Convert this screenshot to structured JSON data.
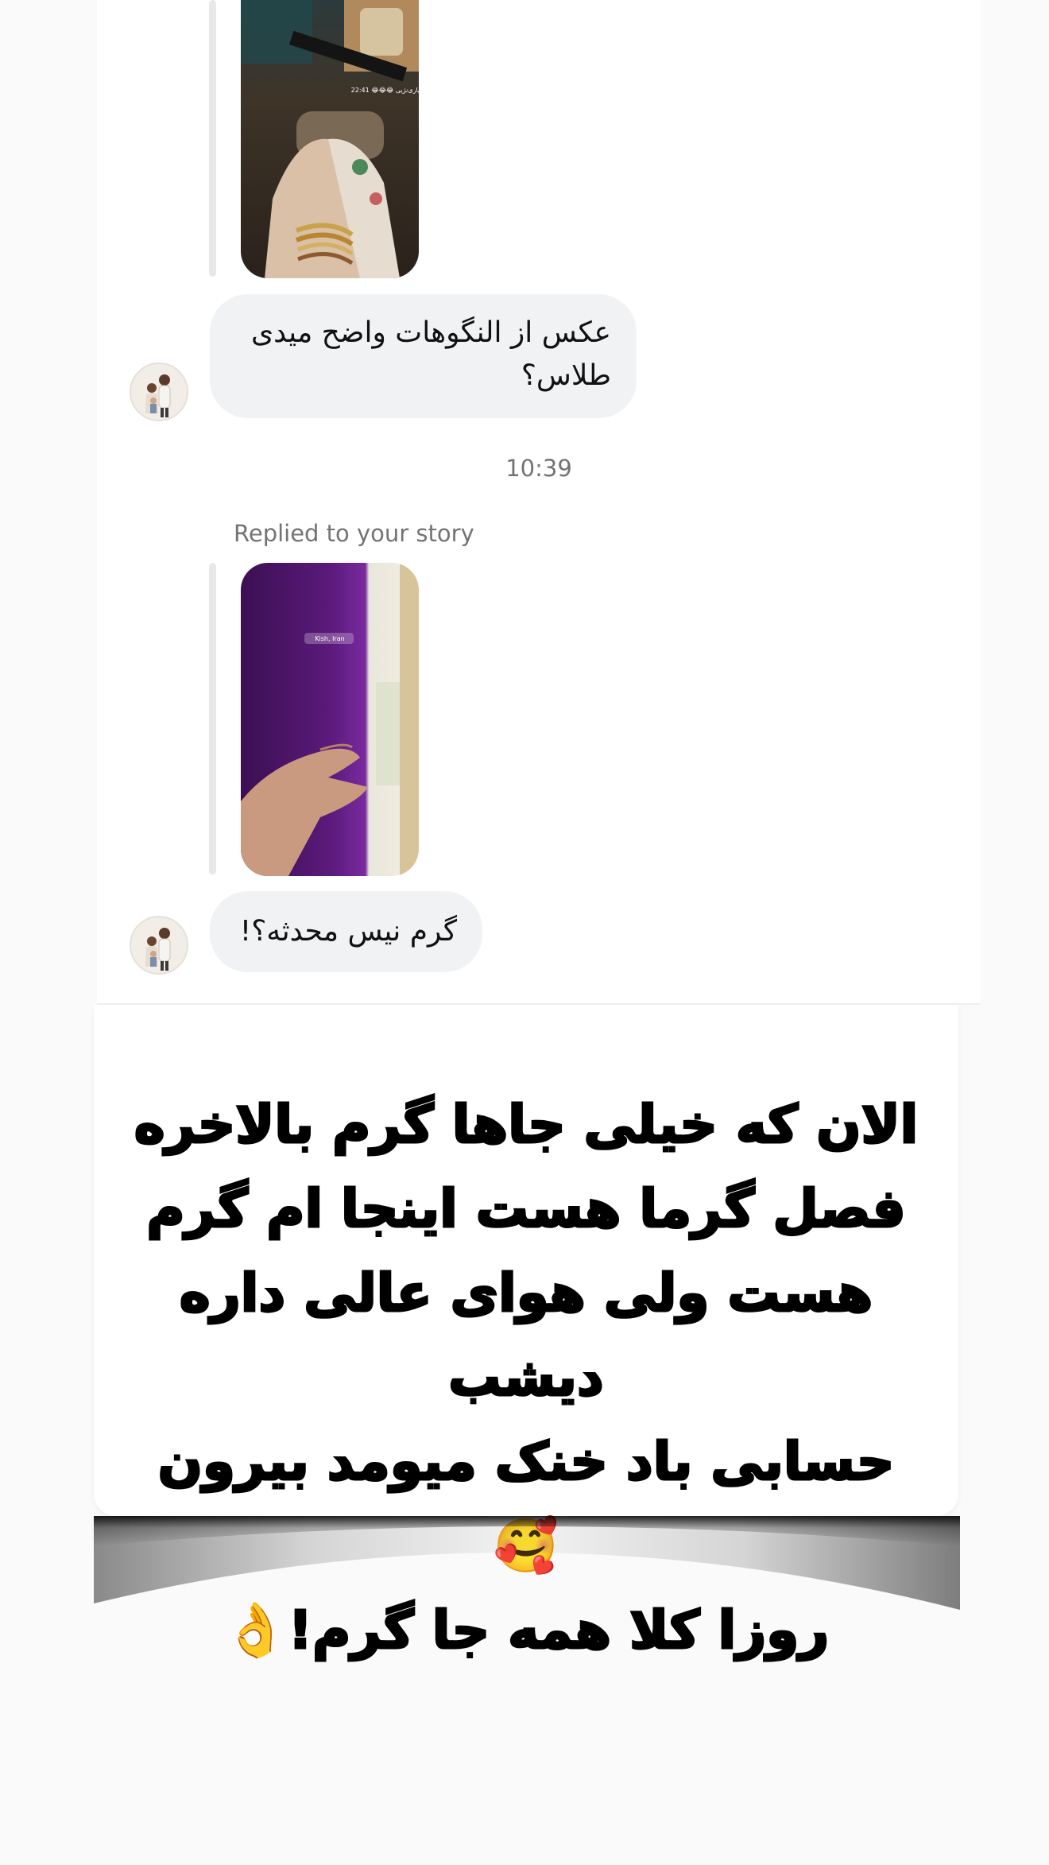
{
  "messages": [
    {
      "type": "story_reply",
      "story_overlay_text": "مهیاری‌نژیی 😂😂😂 22:41",
      "text": "عکس از النگوهات واضح میدی طلاس؟"
    },
    {
      "type": "story_reply",
      "timestamp": "10:39",
      "reply_label": "Replied to your story",
      "story_overlay_text": "Kish, Iran",
      "text": "گرم نیس محدثه؟!"
    }
  ],
  "caption": {
    "lines": [
      "الان که خیلی جاها گرم بالاخره",
      "فصل گرما هست اینجا ام گرم",
      "هست ولی هوای عالی داره دیشب",
      "حسابی باد خنک میومد بیرون 🥰",
      "روزا کلا همه جا گرم!👌"
    ]
  },
  "colors": {
    "bubble_bg": "#f1f2f4",
    "secondary_text": "#737373",
    "reply_bar": "#e8e8e8",
    "page_bg": "#fafafa"
  },
  "icons": {
    "avatar": "couple-illustration-avatar"
  }
}
